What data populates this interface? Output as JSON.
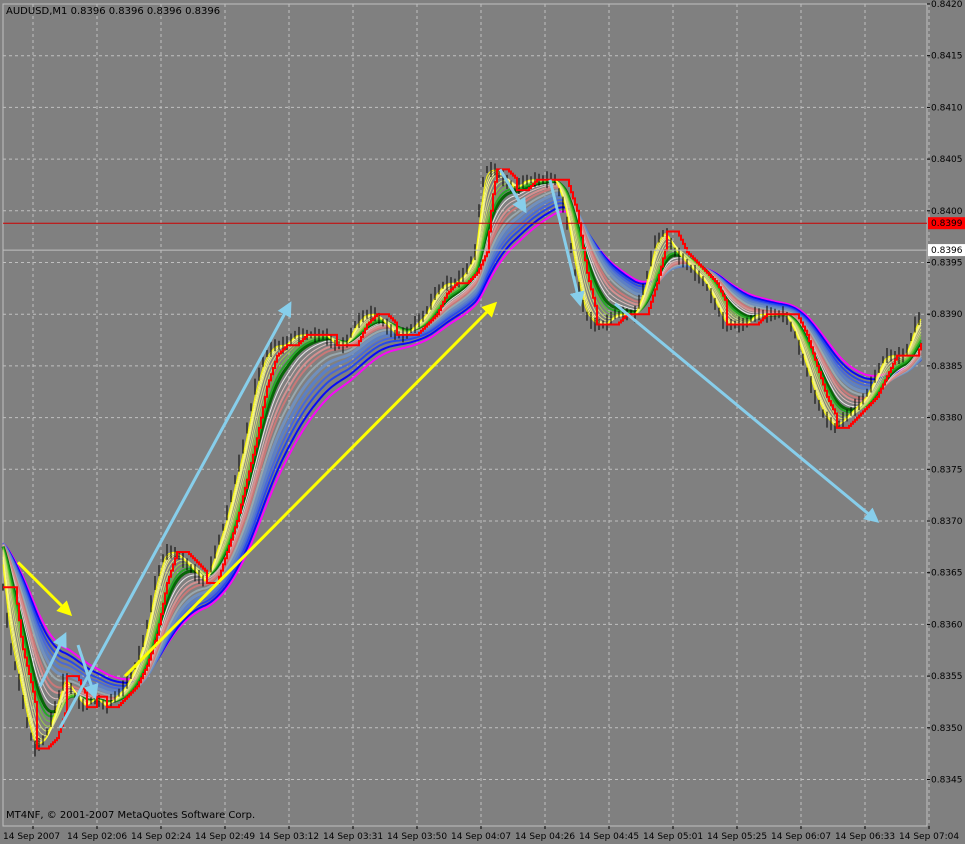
{
  "header": {
    "symbol_line": "AUDUSD,M1  0.8396 0.8396 0.8396 0.8396",
    "copyright": "MT4NF, © 2001-2007 MetaQuotes Software Corp."
  },
  "colors": {
    "background": "#808080",
    "grid": "#c0c0c0",
    "candles": "#000000",
    "red_price_line": "#ff0000",
    "bid_line": "#c0c0c0",
    "arrow_blue": "#87ceeb",
    "arrow_yellow": "#ffff00"
  },
  "chart_data": {
    "type": "line",
    "symbol": "AUDUSD",
    "timeframe": "M1",
    "y_ticks": [
      "0.8420",
      "0.8415",
      "0.8410",
      "0.8405",
      "0.8400",
      "0.8395",
      "0.8390",
      "0.8385",
      "0.8380",
      "0.8375",
      "0.8370",
      "0.8365",
      "0.8360",
      "0.8355",
      "0.8350",
      "0.8345"
    ],
    "x_ticks": [
      "14 Sep 2007",
      "14 Sep 02:06",
      "14 Sep 02:24",
      "14 Sep 02:49",
      "14 Sep 03:12",
      "14 Sep 03:31",
      "14 Sep 03:50",
      "14 Sep 04:07",
      "14 Sep 04:26",
      "14 Sep 04:45",
      "14 Sep 05:01",
      "14 Sep 05:25",
      "14 Sep 06:07",
      "14 Sep 06:33",
      "14 Sep 07:04"
    ],
    "ylim": [
      0.834,
      0.842
    ],
    "grid": true,
    "price_levels": [
      {
        "label": "0.8399",
        "value": 0.83988,
        "color": "#ff0000"
      },
      {
        "label": "0.8396",
        "value": 0.83962,
        "color": "#ffffff"
      }
    ],
    "price_track": [
      [
        0,
        0.8366
      ],
      [
        10,
        0.8358
      ],
      [
        20,
        0.8354
      ],
      [
        28,
        0.835
      ],
      [
        35,
        0.8348
      ],
      [
        45,
        0.8349
      ],
      [
        55,
        0.8352
      ],
      [
        65,
        0.8355
      ],
      [
        75,
        0.8353
      ],
      [
        85,
        0.8352
      ],
      [
        95,
        0.8353
      ],
      [
        105,
        0.8352
      ],
      [
        115,
        0.8353
      ],
      [
        125,
        0.8354
      ],
      [
        135,
        0.8356
      ],
      [
        145,
        0.8359
      ],
      [
        155,
        0.8364
      ],
      [
        165,
        0.8367
      ],
      [
        175,
        0.8367
      ],
      [
        185,
        0.8366
      ],
      [
        195,
        0.8365
      ],
      [
        205,
        0.8364
      ],
      [
        215,
        0.8367
      ],
      [
        225,
        0.837
      ],
      [
        235,
        0.8374
      ],
      [
        245,
        0.8378
      ],
      [
        255,
        0.8383
      ],
      [
        265,
        0.8386
      ],
      [
        275,
        0.8387
      ],
      [
        285,
        0.8387
      ],
      [
        295,
        0.8388
      ],
      [
        305,
        0.8388
      ],
      [
        315,
        0.8388
      ],
      [
        325,
        0.8388
      ],
      [
        335,
        0.8387
      ],
      [
        345,
        0.8387
      ],
      [
        355,
        0.8389
      ],
      [
        365,
        0.839
      ],
      [
        375,
        0.839
      ],
      [
        385,
        0.8389
      ],
      [
        395,
        0.8388
      ],
      [
        405,
        0.8388
      ],
      [
        415,
        0.8389
      ],
      [
        425,
        0.839
      ],
      [
        435,
        0.8392
      ],
      [
        445,
        0.8393
      ],
      [
        455,
        0.8393
      ],
      [
        465,
        0.8394
      ],
      [
        475,
        0.8396
      ],
      [
        480,
        0.8401
      ],
      [
        485,
        0.8404
      ],
      [
        495,
        0.8404
      ],
      [
        505,
        0.8403
      ],
      [
        515,
        0.8402
      ],
      [
        525,
        0.8403
      ],
      [
        535,
        0.8403
      ],
      [
        545,
        0.8403
      ],
      [
        555,
        0.8403
      ],
      [
        565,
        0.84
      ],
      [
        575,
        0.8394
      ],
      [
        585,
        0.839
      ],
      [
        595,
        0.8389
      ],
      [
        605,
        0.8389
      ],
      [
        615,
        0.839
      ],
      [
        625,
        0.839
      ],
      [
        635,
        0.839
      ],
      [
        645,
        0.8393
      ],
      [
        655,
        0.8397
      ],
      [
        665,
        0.8398
      ],
      [
        675,
        0.8396
      ],
      [
        685,
        0.8395
      ],
      [
        695,
        0.8394
      ],
      [
        705,
        0.8393
      ],
      [
        715,
        0.8391
      ],
      [
        725,
        0.8389
      ],
      [
        735,
        0.8389
      ],
      [
        745,
        0.8389
      ],
      [
        755,
        0.839
      ],
      [
        765,
        0.839
      ],
      [
        775,
        0.839
      ],
      [
        785,
        0.839
      ],
      [
        795,
        0.8388
      ],
      [
        805,
        0.8385
      ],
      [
        815,
        0.8382
      ],
      [
        825,
        0.838
      ],
      [
        835,
        0.8379
      ],
      [
        845,
        0.838
      ],
      [
        855,
        0.8381
      ],
      [
        865,
        0.8382
      ],
      [
        875,
        0.8384
      ],
      [
        885,
        0.8386
      ],
      [
        895,
        0.8386
      ],
      [
        905,
        0.8386
      ],
      [
        915,
        0.8389
      ],
      [
        922,
        0.839
      ]
    ],
    "annotations": [
      {
        "type": "arrow",
        "color": "#87ceeb",
        "from": [
          60,
          0.835
        ],
        "to": [
          290,
          0.8391
        ]
      },
      {
        "type": "arrow",
        "color": "#87ceeb",
        "from": [
          40,
          0.8354
        ],
        "to": [
          65,
          0.8359
        ]
      },
      {
        "type": "arrow",
        "color": "#87ceeb",
        "from": [
          78,
          0.8358
        ],
        "to": [
          95,
          0.8353
        ]
      },
      {
        "type": "arrow",
        "color": "#ffff00",
        "from": [
          18,
          0.8366
        ],
        "to": [
          70,
          0.8361
        ]
      },
      {
        "type": "arrow",
        "color": "#ffff00",
        "from": [
          125,
          0.8355
        ],
        "to": [
          495,
          0.8391
        ]
      },
      {
        "type": "arrow",
        "color": "#87ceeb",
        "from": [
          500,
          0.8404
        ],
        "to": [
          525,
          0.84
        ]
      },
      {
        "type": "arrow",
        "color": "#87ceeb",
        "from": [
          550,
          0.8403
        ],
        "to": [
          580,
          0.8391
        ]
      },
      {
        "type": "arrow",
        "color": "#87ceeb",
        "from": [
          615,
          0.8391
        ],
        "to": [
          877,
          0.837
        ]
      }
    ]
  }
}
